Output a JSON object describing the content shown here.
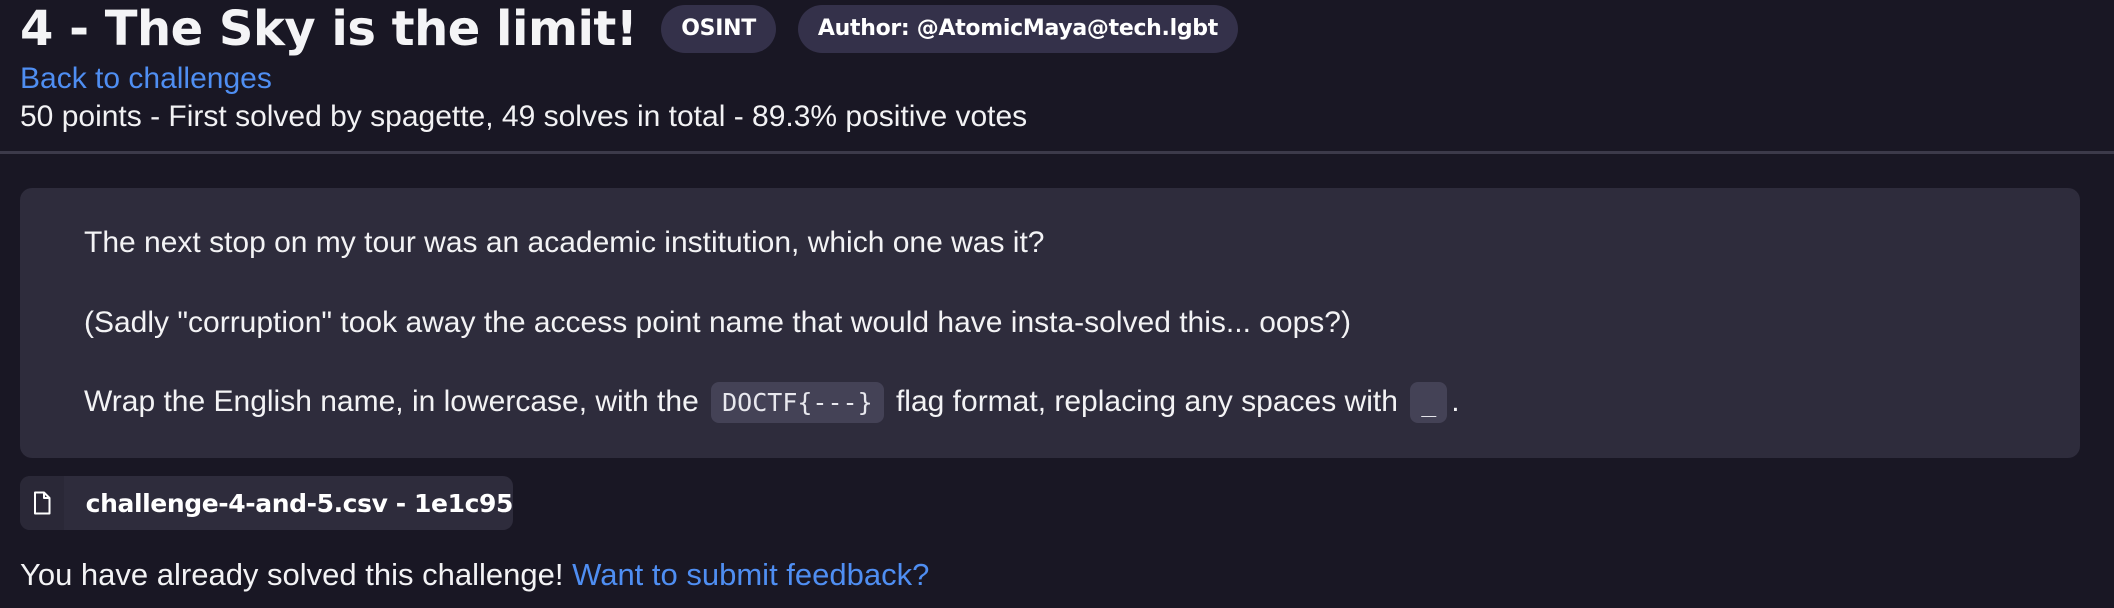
{
  "challenge": {
    "title": "4 - The Sky is the limit!",
    "category": "OSINT",
    "author": "Author: @AtomicMaya@tech.lgbt",
    "back_link": "Back to challenges",
    "meta": "50 points - First solved by spagette, 49 solves in total - 89.3% positive votes"
  },
  "description": {
    "line1": "The next stop on my tour was an academic institution, which one was it?",
    "line2": "(Sadly \"corruption\" took away the access point name that would have insta-solved this... oops?)",
    "line3_prefix": "Wrap the English name, in lowercase, with the",
    "flag_format": "DOCTF{---}",
    "line3_middle": "flag format, replacing any spaces with",
    "space_replacement": "_",
    "line3_suffix": "."
  },
  "attachment": {
    "icon": "file-icon",
    "label": "challenge-4-and-5.csv - 1e1c95"
  },
  "status": {
    "solved_text": "You have already solved this challenge!",
    "feedback_link": "Want to submit feedback?"
  },
  "colors": {
    "background": "#191724",
    "card": "#2e2c3c",
    "pill": "#34314a",
    "link": "#4f8ef2"
  }
}
